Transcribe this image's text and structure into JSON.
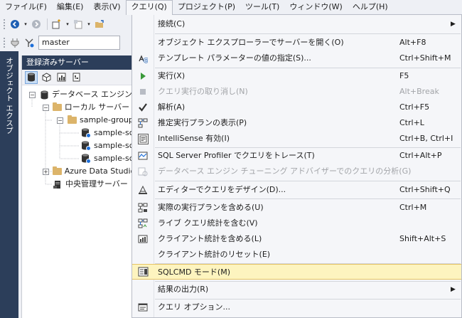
{
  "menubar": {
    "items": [
      {
        "label": "ファイル(F)"
      },
      {
        "label": "編集(E)"
      },
      {
        "label": "表示(V)"
      },
      {
        "label": "クエリ(Q)",
        "active": true
      },
      {
        "label": "プロジェクト(P)"
      },
      {
        "label": "ツール(T)"
      },
      {
        "label": "ウィンドウ(W)"
      },
      {
        "label": "ヘルプ(H)"
      }
    ]
  },
  "toolbar": {
    "database_value": "master"
  },
  "vertical_tab": {
    "label": "オブジェクト エクスプローラー"
  },
  "panel": {
    "title": "登録済みサーバー",
    "tree": [
      {
        "label": "データベース エンジン",
        "level": 0,
        "icon": "database-icon",
        "expander": "−"
      },
      {
        "label": "ローカル サーバー グ",
        "level": 1,
        "icon": "folder-icon",
        "expander": "−"
      },
      {
        "label": "sample-group",
        "level": 2,
        "icon": "folder-icon",
        "expander": "−"
      },
      {
        "label": "sample-sc",
        "level": 3,
        "icon": "server-icon",
        "expander": ""
      },
      {
        "label": "sample-sc",
        "level": 3,
        "icon": "server-icon",
        "expander": ""
      },
      {
        "label": "sample-sc",
        "level": 3,
        "icon": "server-icon",
        "expander": ""
      },
      {
        "label": "Azure Data Studio",
        "level": 1,
        "icon": "folder-icon",
        "expander": "+"
      },
      {
        "label": "中央管理サーバー",
        "level": 1,
        "icon": "central-server-icon",
        "expander": ""
      }
    ]
  },
  "dropdown": {
    "items": [
      {
        "label": "接続(C)",
        "shortcut": "",
        "submenu": true,
        "icon": "",
        "disabled": false
      },
      {
        "sep": true
      },
      {
        "label": "オブジェクト エクスプローラーでサーバーを開く(O)",
        "shortcut": "Alt+F8",
        "icon": "",
        "disabled": false
      },
      {
        "label": "テンプレート パラメーターの値の指定(S)...",
        "shortcut": "Ctrl+Shift+M",
        "icon": "template-params-icon",
        "disabled": false
      },
      {
        "sep": true
      },
      {
        "label": "実行(X)",
        "shortcut": "F5",
        "icon": "play-icon",
        "disabled": false
      },
      {
        "label": "クエリ実行の取り消し(N)",
        "shortcut": "Alt+Break",
        "icon": "stop-icon",
        "disabled": true
      },
      {
        "label": "解析(A)",
        "shortcut": "Ctrl+F5",
        "icon": "checkmark-icon",
        "disabled": false
      },
      {
        "label": "推定実行プランの表示(P)",
        "shortcut": "Ctrl+L",
        "icon": "estimated-plan-icon",
        "disabled": false
      },
      {
        "label": "IntelliSense 有効(I)",
        "shortcut": "Ctrl+B, Ctrl+I",
        "icon": "intellisense-icon",
        "disabled": false
      },
      {
        "sep": true
      },
      {
        "label": "SQL Server Profiler でクエリをトレース(T)",
        "shortcut": "Ctrl+Alt+P",
        "icon": "profiler-icon",
        "disabled": false
      },
      {
        "label": "データベース エンジン チューニング アドバイザーでのクエリの分析(G)",
        "shortcut": "",
        "icon": "tuning-advisor-icon",
        "disabled": true
      },
      {
        "sep": true
      },
      {
        "label": "エディターでクエリをデザイン(D)...",
        "shortcut": "Ctrl+Shift+Q",
        "icon": "query-designer-icon",
        "disabled": false
      },
      {
        "sep": true
      },
      {
        "label": "実際の実行プランを含める(U)",
        "shortcut": "Ctrl+M",
        "icon": "actual-plan-icon",
        "disabled": false
      },
      {
        "label": "ライブ クエリ統計を含む(V)",
        "shortcut": "",
        "icon": "live-stats-icon",
        "disabled": false
      },
      {
        "label": "クライアント統計を含める(L)",
        "shortcut": "Shift+Alt+S",
        "icon": "client-stats-icon",
        "disabled": false
      },
      {
        "label": "クライアント統計のリセット(E)",
        "shortcut": "",
        "icon": "",
        "disabled": false
      },
      {
        "sep": true
      },
      {
        "label": "SQLCMD モード(M)",
        "shortcut": "",
        "icon": "sqlcmd-icon",
        "disabled": false,
        "highlighted": true
      },
      {
        "sep": true
      },
      {
        "label": "結果の出力(R)",
        "shortcut": "",
        "submenu": true,
        "icon": "",
        "disabled": false
      },
      {
        "sep": true
      },
      {
        "label": "クエリ オプション...",
        "shortcut": "",
        "icon": "query-options-icon",
        "disabled": false
      }
    ]
  },
  "colors": {
    "panel_header": "#2c3e5a",
    "highlight_bg": "#fdf4bf",
    "highlight_border": "#e5c365",
    "disabled_text": "#a2a4a8"
  }
}
